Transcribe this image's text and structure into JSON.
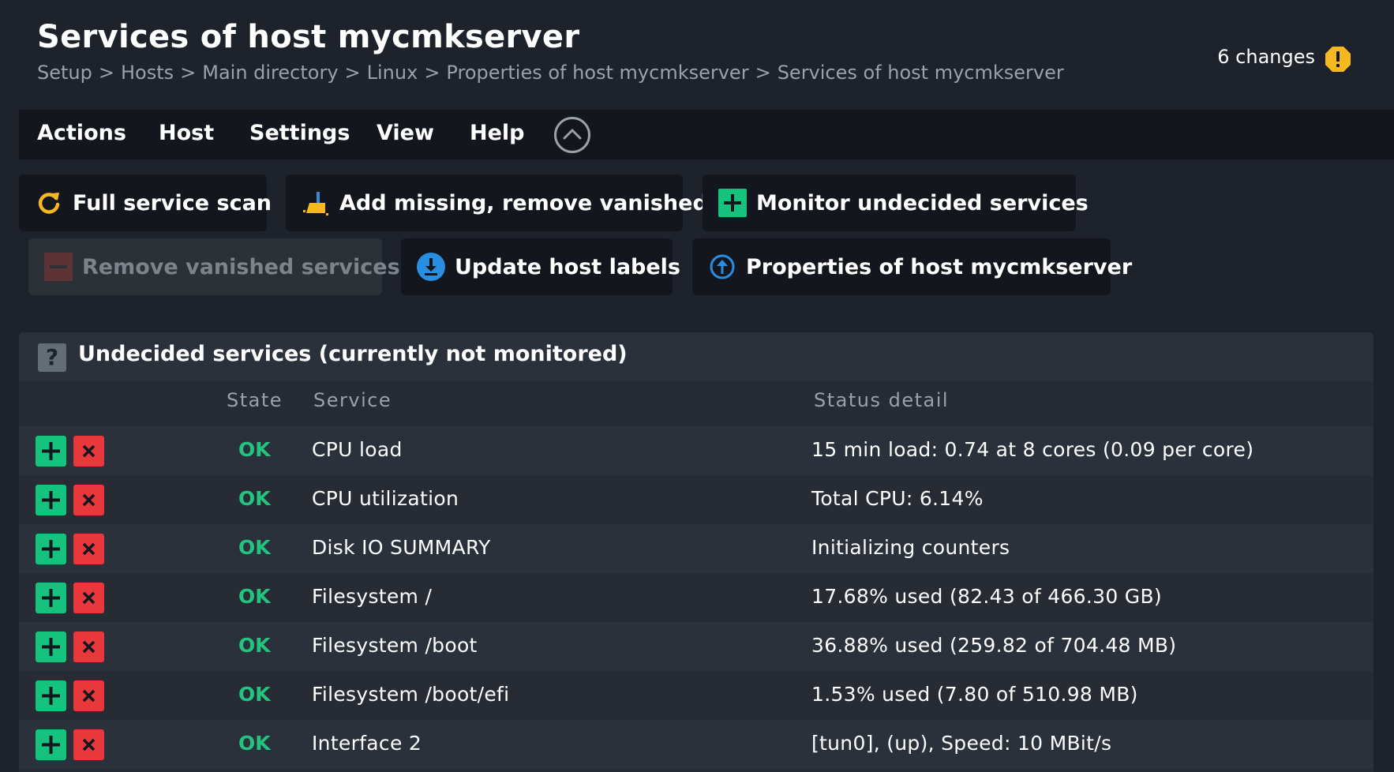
{
  "header": {
    "title": "Services of host mycmkserver",
    "breadcrumb": [
      "Setup",
      "Hosts",
      "Main directory",
      "Linux",
      "Properties of host mycmkserver",
      "Services of host mycmkserver"
    ],
    "breadcrumb_sep": ">",
    "changes_label": "6 changes",
    "changes_icon": "warning-icon"
  },
  "menubar": {
    "items": [
      "Actions",
      "Host",
      "Settings",
      "View",
      "Help"
    ],
    "collapse_icon": "chevron-up-icon"
  },
  "actions": {
    "full_scan": {
      "label": "Full service scan",
      "icon": "refresh-icon"
    },
    "add_missing": {
      "label": "Add missing, remove vanished",
      "icon": "broom-icon"
    },
    "monitor_undecided": {
      "label": "Monitor undecided services",
      "icon": "plus-icon"
    },
    "remove_vanished": {
      "label": "Remove vanished services",
      "icon": "minus-icon",
      "disabled": true
    },
    "update_labels": {
      "label": "Update host labels",
      "icon": "download-icon"
    },
    "properties": {
      "label": "Properties of host mycmkserver",
      "icon": "up-arrow-circle-icon"
    }
  },
  "table": {
    "title": "Undecided services (currently not monitored)",
    "columns": {
      "state": "State",
      "service": "Service",
      "detail": "Status detail"
    },
    "rows": [
      {
        "state": "OK",
        "service": "CPU load",
        "detail": "15 min load: 0.74 at 8 cores (0.09 per core)"
      },
      {
        "state": "OK",
        "service": "CPU utilization",
        "detail": "Total CPU: 6.14%"
      },
      {
        "state": "OK",
        "service": "Disk IO SUMMARY",
        "detail": "Initializing counters"
      },
      {
        "state": "OK",
        "service": "Filesystem /",
        "detail": "17.68% used (82.43 of 466.30 GB)"
      },
      {
        "state": "OK",
        "service": "Filesystem /boot",
        "detail": "36.88% used (259.82 of 704.48 MB)"
      },
      {
        "state": "OK",
        "service": "Filesystem /boot/efi",
        "detail": "1.53% used (7.80 of 510.98 MB)"
      },
      {
        "state": "OK",
        "service": "Interface 2",
        "detail": "[tun0], (up), Speed: 10 MBit/s"
      }
    ]
  },
  "colors": {
    "background": "#1e232b",
    "ok": "#22c47f",
    "add": "#15c27e",
    "remove": "#e8383c",
    "warning": "#f5b821"
  }
}
